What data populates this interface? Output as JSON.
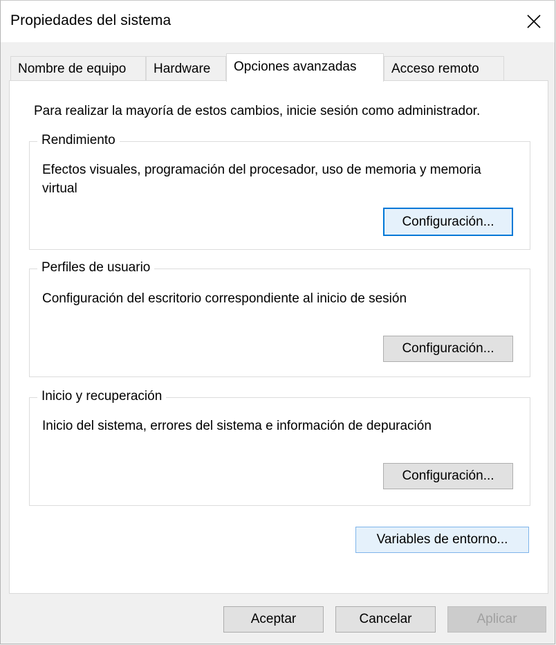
{
  "window": {
    "title": "Propiedades del sistema"
  },
  "icons": {
    "close": "close-icon"
  },
  "tabs": [
    {
      "label": "Nombre de equipo",
      "selected": false
    },
    {
      "label": "Hardware",
      "selected": false
    },
    {
      "label": "Opciones avanzadas",
      "selected": true
    },
    {
      "label": "Acceso remoto",
      "selected": false
    }
  ],
  "intro_text": "Para realizar la mayoría de estos cambios, inicie sesión como administrador.",
  "groups": {
    "performance": {
      "title": "Rendimiento",
      "description": "Efectos visuales, programación del procesador, uso de memoria y memoria virtual",
      "button": "Configuración..."
    },
    "user_profiles": {
      "title": "Perfiles de usuario",
      "description": "Configuración del escritorio correspondiente al inicio de sesión",
      "button": "Configuración..."
    },
    "startup_recovery": {
      "title": "Inicio y recuperación",
      "description": "Inicio del sistema, errores del sistema e información de depuración",
      "button": "Configuración..."
    }
  },
  "env_vars_button": "Variables de entorno...",
  "footer": {
    "ok": "Aceptar",
    "cancel": "Cancelar",
    "apply": "Aplicar"
  },
  "colors": {
    "accent_focus": "#0078d7",
    "window_bg": "#f0f0f0",
    "panel_bg": "#ffffff",
    "disabled_text": "#a0a0a0"
  }
}
